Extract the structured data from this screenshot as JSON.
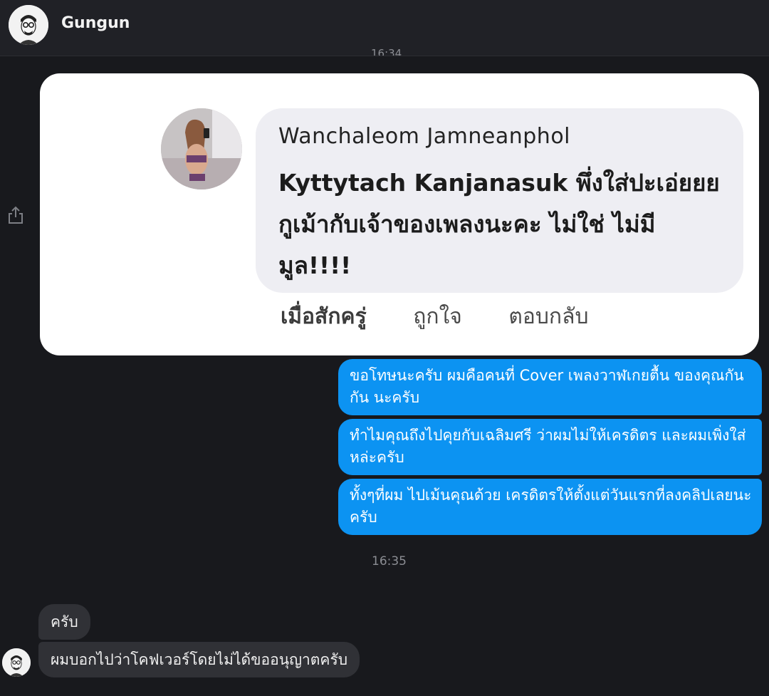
{
  "header": {
    "contact_name": "Gungun",
    "avatar_icon": "avatar-cartoon-glasses-icon"
  },
  "timestamps": {
    "top": "16:34",
    "middle": "16:35"
  },
  "image_card": {
    "author": "Wanchaleom Jamneanphol",
    "comment": "Kyttytach Kanjanasuk พึ่งใส่ปะเอ่ยยย กูเม้ากับเจ้าของเพลงนะคะ ไม่ใช่ ไม่มีมูล!!!!",
    "actions": {
      "time": "เมื่อสักครู่",
      "like": "ถูกใจ",
      "reply": "ตอบกลับ"
    }
  },
  "outgoing": [
    "ขอโทษนะครับ ผมคือคนที่ Cover เพลงวาฬเกยตื้น ของคุณกันกัน นะครับ",
    "ทำไมคุณถึงไปคุยกับเฉลิมศรี ว่าผมไม่ให้เครดิตร และผมเพิ่งใส่หล่ะครับ",
    "ทั้งๆที่ผม ไปเม้นคุณด้วย เครดิตรให้ตั้งแต่วันแรกที่ลงคลิปเลยนะครับ"
  ],
  "incoming": [
    "ครับ",
    "ผมบอกไปว่าโคฟเวอร์โดยไม่ได้ขออนุญาตครับ"
  ],
  "colors": {
    "background": "#18191d",
    "outgoing_bubble": "#0c93f2",
    "incoming_bubble": "#303136"
  }
}
